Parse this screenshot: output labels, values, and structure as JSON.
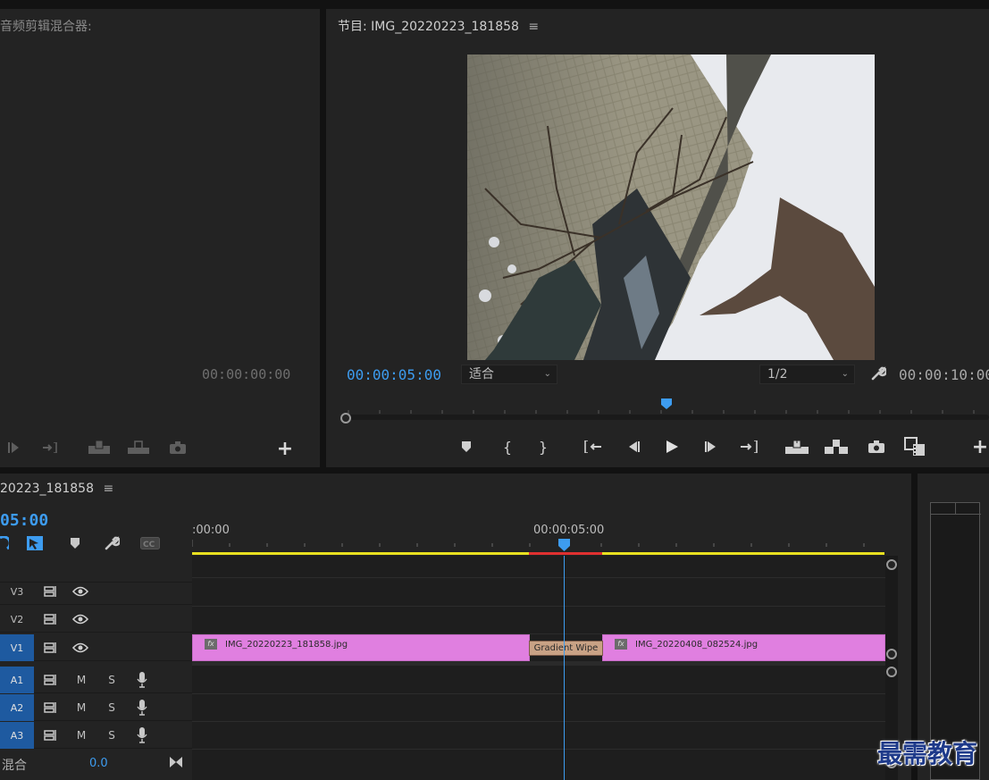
{
  "left_panel": {
    "title": "音频剪辑混合器:",
    "timecode": "00:00:00:00"
  },
  "program_monitor": {
    "title": "节目: IMG_20220223_181858",
    "menu_icon": "hamburger-icon",
    "playhead_timecode": "00:00:05:00",
    "zoom_value": "适合",
    "resolution_value": "1/2",
    "duration_timecode": "00:00:10:00"
  },
  "timeline": {
    "title": "20223_181858",
    "sequence_timecode": "05:00",
    "ruler_labels": [
      ":00:00",
      "00:00:05:00"
    ],
    "tracks": [
      {
        "label": "V3",
        "active": false,
        "kind": "video"
      },
      {
        "label": "V2",
        "active": false,
        "kind": "video"
      },
      {
        "label": "V1",
        "active": true,
        "kind": "video"
      },
      {
        "label": "A1",
        "active": true,
        "kind": "audio"
      },
      {
        "label": "A2",
        "active": true,
        "kind": "audio"
      },
      {
        "label": "A3",
        "active": true,
        "kind": "audio"
      }
    ],
    "audio_mute": "M",
    "audio_solo": "S",
    "clips": [
      {
        "name": "IMG_20220223_181858.jpg",
        "fx": "fx"
      },
      {
        "name": "IMG_20220408_082524.jpg",
        "fx": "fx"
      }
    ],
    "transition": "Gradient Wipe",
    "mix_label": "混合",
    "mix_value": "0.0"
  },
  "watermark": "最需教育",
  "colors": {
    "accent": "#3d9cf0",
    "clip": "#e07fe0",
    "transition": "#c9a285",
    "work_area": "#e8e020",
    "render_red": "#e03030",
    "track_active": "#1e5aa0"
  }
}
